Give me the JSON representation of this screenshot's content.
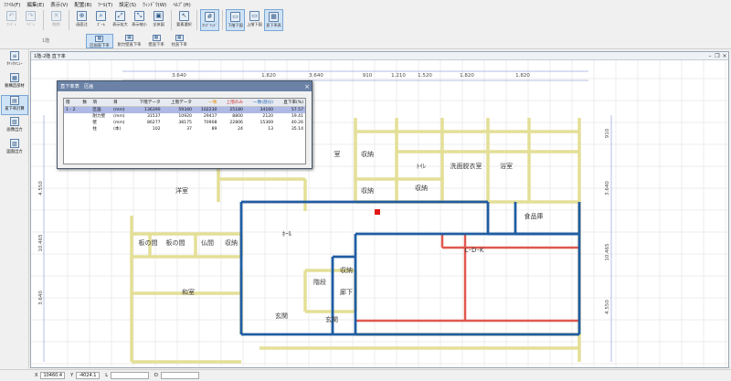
{
  "menu": [
    "ﾌｧｲﾙ(F)",
    "編集(E)",
    "表示(V)",
    "配置(B)",
    "ﾂｰﾙ(T)",
    "設定(S)",
    "ｳｨﾝﾄﾞｳ(W)",
    "ﾍﾙﾌﾟ(H)"
  ],
  "toolbar": {
    "groups": [
      [
        {
          "label": "ｱﾝﾄﾞｩ",
          "icon": "undo-icon",
          "glyph": "↶",
          "dim": true
        },
        {
          "label": "ﾘﾄﾞｩ",
          "icon": "redo-icon",
          "glyph": "↷",
          "dim": true
        }
      ],
      [
        {
          "label": "削除",
          "icon": "delete-icon",
          "glyph": "✕",
          "dim": true
        }
      ],
      [
        {
          "label": "画面注",
          "icon": "zoom-in-icon",
          "glyph": "⊕",
          "dim": false
        },
        {
          "label": "ｽﾞｰﾑ",
          "icon": "zoom-icon",
          "glyph": "⌕",
          "dim": false
        },
        {
          "label": "表示拡大",
          "icon": "expand-icon",
          "glyph": "⤢",
          "dim": false
        },
        {
          "label": "表示縮小",
          "icon": "shrink-icon",
          "glyph": "⤡",
          "dim": false
        },
        {
          "label": "全体図",
          "icon": "fit-icon",
          "glyph": "▣",
          "dim": false
        }
      ],
      [
        {
          "label": "要素選択",
          "icon": "cursor-icon",
          "glyph": "↖",
          "dim": false
        }
      ],
      [
        {
          "label": "ｵﾝｸﾞﾘｯﾄﾞ",
          "icon": "grid-icon",
          "glyph": "#",
          "active": true
        }
      ],
      [
        {
          "label": "下階下図",
          "icon": "lower-floor-icon",
          "glyph": "▭",
          "active": true
        },
        {
          "label": "上階下図",
          "icon": "upper-floor-icon",
          "glyph": "▭",
          "active": false
        },
        {
          "label": "直下率表",
          "icon": "ratio-table-icon",
          "glyph": "▦",
          "active": true
        }
      ]
    ],
    "floor_label": "1階"
  },
  "toolbar2": [
    {
      "label": "区画直下率",
      "icon": "section-ratio-icon",
      "active": true
    },
    {
      "label": "耐力壁直下率",
      "icon": "bearing-wall-icon",
      "active": false
    },
    {
      "label": "壁直下率",
      "icon": "wall-ratio-icon",
      "active": false
    },
    {
      "label": "柱直下率",
      "icon": "column-ratio-icon",
      "active": false
    }
  ],
  "sidebar": [
    {
      "label": "ｸｲｯｸﾒﾆｭｰ",
      "icon": "menu-icon",
      "glyph": "≡",
      "active": false
    },
    {
      "label": "躯構造部材",
      "icon": "structure-icon",
      "glyph": "▦",
      "active": false
    },
    {
      "label": "直下率計算",
      "icon": "calc-icon",
      "glyph": "▤",
      "active": true
    },
    {
      "label": "画像出力",
      "icon": "image-output-icon",
      "glyph": "▧",
      "active": false
    },
    {
      "label": "図面出力",
      "icon": "drawing-output-icon",
      "glyph": "▨",
      "active": false
    }
  ],
  "document": {
    "title": "1階-2階 直下率"
  },
  "dimensions": {
    "top": [
      "3.640",
      "1.820",
      "3.640",
      "910",
      "1.210",
      "1.520",
      "1.820",
      "1.820"
    ],
    "left": [
      "4.550",
      "10.465",
      "3.640"
    ],
    "right": [
      "910",
      "3.640",
      "10.465",
      "4.550"
    ]
  },
  "rooms": [
    {
      "label": "洋室"
    },
    {
      "label": "収納"
    },
    {
      "label": "ﾄｲﾚ"
    },
    {
      "label": "洗面脱衣室"
    },
    {
      "label": "浴室"
    },
    {
      "label": "収納"
    },
    {
      "label": "収納"
    },
    {
      "label": "食品庫"
    },
    {
      "label": "ﾎｰﾙ"
    },
    {
      "label": "L･D･K"
    },
    {
      "label": "板の間"
    },
    {
      "label": "板の間"
    },
    {
      "label": "仏間"
    },
    {
      "label": "収納"
    },
    {
      "label": "和室"
    },
    {
      "label": "階段"
    },
    {
      "label": "収納"
    },
    {
      "label": "廊下"
    },
    {
      "label": "玄関"
    },
    {
      "label": "玄関"
    },
    {
      "label": "室"
    }
  ],
  "dialog": {
    "title": "直下率表　区画",
    "headers": [
      "階",
      "数",
      "項",
      "目",
      "下階データ",
      "上階データ",
      "一致",
      "上階のみ",
      "一致(部分)",
      "直下率(%)"
    ],
    "rows": [
      [
        "1 - 2",
        "",
        "区画",
        "(mm)",
        "136390",
        "59340",
        "102230",
        "25180",
        "34160",
        "57.57"
      ],
      [
        "",
        "",
        "耐力壁",
        "(mm)",
        "31537",
        "10920",
        "29417",
        "8800",
        "2120",
        "19.41"
      ],
      [
        "",
        "",
        "壁",
        "(mm)",
        "86277",
        "38175",
        "70908",
        "22806",
        "15369",
        "40.26"
      ],
      [
        "",
        "",
        "柱",
        "(本)",
        "102",
        "37",
        "89",
        "24",
        "13",
        "35.14"
      ]
    ]
  },
  "status": {
    "x_label": "X",
    "x_value": "10460.4",
    "y_label": "Y",
    "y_value": "-4024.1",
    "l_label": "L",
    "l_value": "",
    "d_label": "D",
    "d_value": ""
  },
  "colors": {
    "wall_yellow": "#e4df96",
    "section_blue": "#1f5da3",
    "upper_only_red": "#e0584e",
    "grid_gray": "#dcdcdc",
    "dim_blue": "#6e7ec6"
  }
}
